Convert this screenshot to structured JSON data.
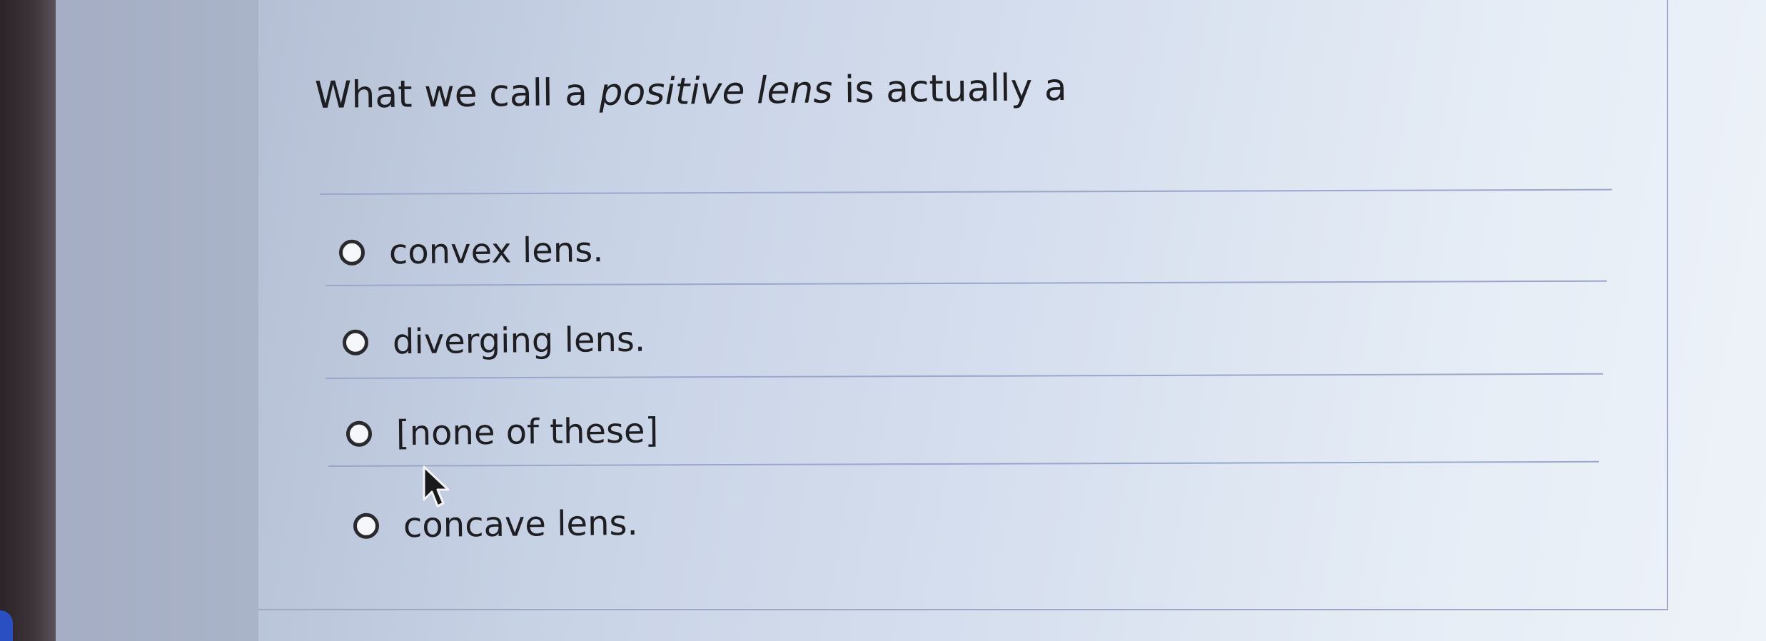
{
  "question": {
    "prefix": "What we call a ",
    "emphasis": "positive lens",
    "suffix": " is actually a"
  },
  "answers": [
    {
      "label": "convex lens.",
      "selected": false
    },
    {
      "label": "diverging lens.",
      "selected": false
    },
    {
      "label": "[none of these]",
      "selected": false
    },
    {
      "label": "concave lens.",
      "selected": false
    }
  ]
}
